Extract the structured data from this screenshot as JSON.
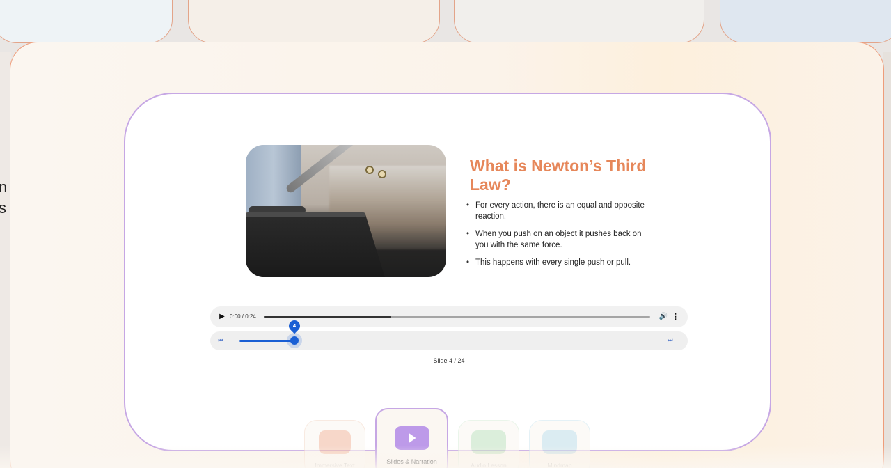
{
  "background": {
    "left_text": "n\ns"
  },
  "slide": {
    "title": "What is Newton’s Third Law?",
    "bullets": [
      "For every action, there is an equal and opposite reaction.",
      "When you push on an object it pushes back on you with the same force.",
      "This happens with every single push or pull."
    ]
  },
  "audio": {
    "time": "0:00 / 0:24",
    "progress": 0.33,
    "play_icon": "play-icon",
    "volume_icon": "volume-icon",
    "more_icon": "more-vert-icon"
  },
  "scrubber": {
    "current": "4",
    "counter": "Slide 4 / 24",
    "accent": "#1a5fd4"
  },
  "tabs": [
    {
      "label": "Immersive Text",
      "icon": "immersive-text-icon"
    },
    {
      "label": "Slides & Narration",
      "icon": "play-icon"
    },
    {
      "label": "Audio Lesson",
      "icon": "waveform-icon"
    },
    {
      "label": "Mindmap",
      "icon": "mindmap-icon"
    }
  ],
  "colors": {
    "title": "#e6875a",
    "card_border": "#c6a7e4",
    "modal_border": "#ee9c7a"
  }
}
